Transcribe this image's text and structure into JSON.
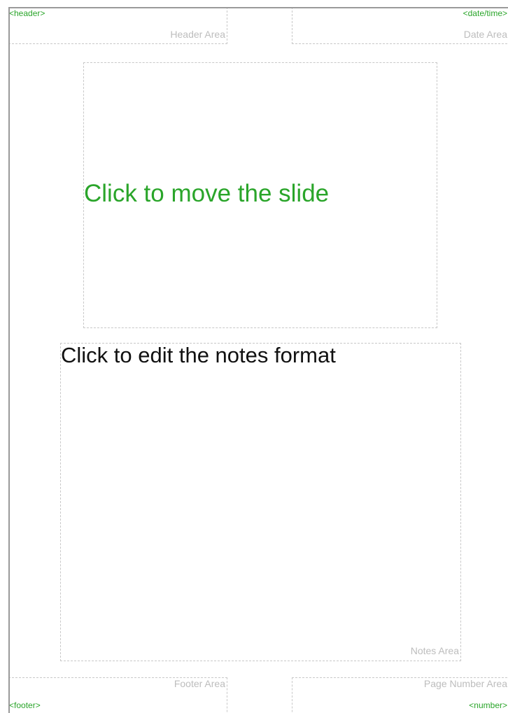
{
  "header": {
    "field": "<header>",
    "area_label": "Header Area"
  },
  "date": {
    "field": "<date/time>",
    "area_label": "Date Area"
  },
  "slide": {
    "label": "Click to move the slide"
  },
  "notes": {
    "label": "Click to edit the notes format",
    "area_label": "Notes Area"
  },
  "footer": {
    "field": "<footer>",
    "area_label": "Footer Area"
  },
  "page_number": {
    "field": "<number>",
    "area_label": "Page Number Area"
  },
  "colors": {
    "field_text": "#2aa52a",
    "area_label": "#bdbdbd",
    "notes_text": "#111111",
    "area_border": "#c8c8c8",
    "page_edge": "#9a9a9a"
  }
}
